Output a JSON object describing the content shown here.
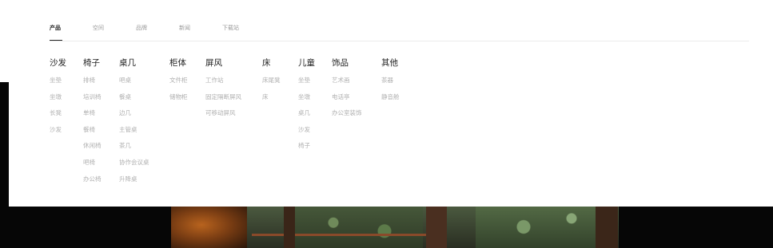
{
  "topnav": {
    "tabs": [
      {
        "label": "产品",
        "active": true
      },
      {
        "label": "空间"
      },
      {
        "label": "品牌"
      },
      {
        "label": "新闻"
      },
      {
        "label": "下载站"
      }
    ]
  },
  "menu": {
    "columns": [
      {
        "title": "沙发",
        "items": [
          "坐垫",
          "坐墩",
          "长凳",
          "沙发"
        ]
      },
      {
        "title": "椅子",
        "items": [
          "排椅",
          "培训椅",
          "单椅",
          "餐椅",
          "休闲椅",
          "吧椅",
          "办公椅"
        ]
      },
      {
        "title": "桌几",
        "items": [
          "吧桌",
          "餐桌",
          "边几",
          "主管桌",
          "茶几",
          "协作会议桌",
          "升降桌"
        ]
      },
      {
        "title": "柜体",
        "items": [
          "文件柜",
          "储物柜"
        ]
      },
      {
        "title": "屏风",
        "items": [
          "工作站",
          "固定隔断屏风",
          "可移动屏风"
        ]
      },
      {
        "title": "床",
        "items": [
          "床尾凳",
          "床"
        ]
      },
      {
        "title": "儿童",
        "items": [
          "坐垫",
          "坐墩",
          "桌几",
          "沙发",
          "椅子"
        ]
      },
      {
        "title": "饰品",
        "items": [
          "艺术画",
          "电话亭",
          "办公室装饰"
        ]
      },
      {
        "title": "其他",
        "items": [
          "茶器",
          "静音舱"
        ]
      }
    ]
  },
  "carousel": {
    "prev_icon": "‹",
    "next_icon": "›"
  },
  "colors": {
    "text_dark": "#222222",
    "text_muted": "#b0b0b0",
    "hero_bg": "#060606"
  }
}
